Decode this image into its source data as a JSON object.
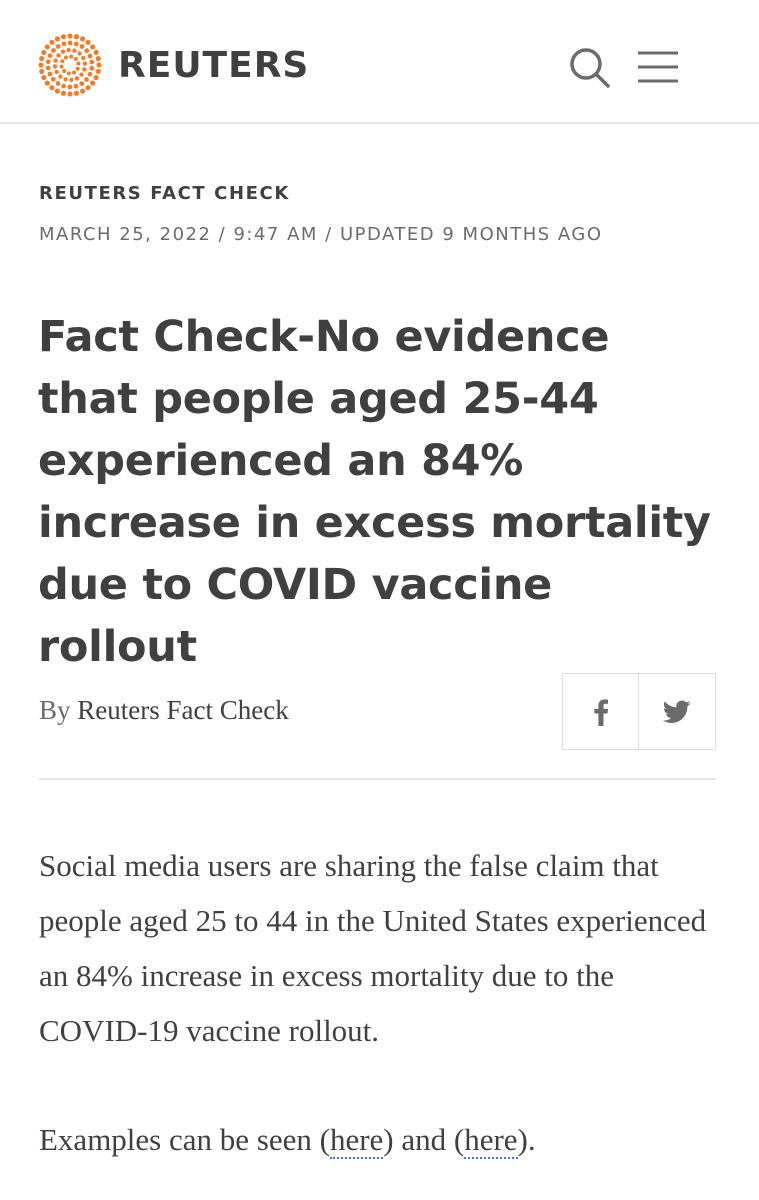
{
  "header": {
    "brand": "REUTERS",
    "logo_icon": "reuters-dot-logo-icon",
    "logo_color": "#f07d2c",
    "search_icon": "search-icon",
    "menu_icon": "hamburger-menu-icon"
  },
  "article": {
    "kicker": "REUTERS FACT CHECK",
    "dateline": "MARCH 25, 2022 / 9:47 AM / UPDATED 9 MONTHS AGO",
    "headline": "Fact Check-No evidence that people aged 25-44 experienced an 84% increase in excess mortality due to COVID vaccine rollout",
    "byline_prefix": "By",
    "byline_author": "Reuters Fact Check",
    "share": {
      "facebook_icon": "facebook-icon",
      "twitter_icon": "twitter-icon"
    },
    "paragraph1": "Social media users are sharing the false claim that people aged 25 to 44 in the United States experienced an 84% increase in excess mortality due to the COVID-19 vaccine rollout.",
    "paragraph2": {
      "lead": "Examples can be seen (",
      "link1": "here",
      "middle": ") and (",
      "link2": "here",
      "tail": ")."
    },
    "link_underline_color": "#3a7bd5"
  }
}
